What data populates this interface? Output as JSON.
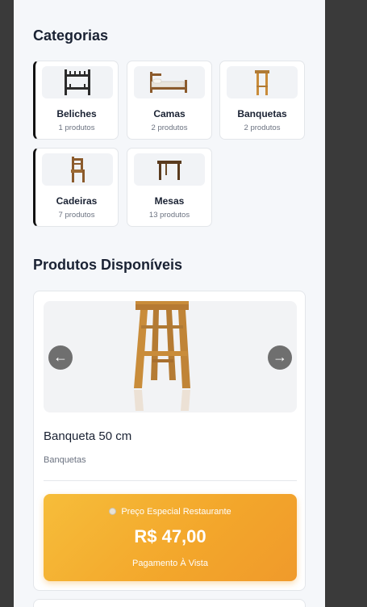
{
  "categories": {
    "title": "Categorias",
    "items": [
      {
        "name": "Beliches",
        "count": "1 produtos",
        "icon": "bunk-bed-icon"
      },
      {
        "name": "Camas",
        "count": "2 produtos",
        "icon": "bed-icon"
      },
      {
        "name": "Banquetas",
        "count": "2 produtos",
        "icon": "stool-icon"
      },
      {
        "name": "Cadeiras",
        "count": "7 produtos",
        "icon": "chair-icon"
      },
      {
        "name": "Mesas",
        "count": "13 produtos",
        "icon": "table-icon"
      }
    ]
  },
  "products": {
    "title": "Produtos Disponíveis",
    "current": {
      "name": "Banqueta 50 cm",
      "category": "Banquetas",
      "image": "wooden-stool-image",
      "prev_label": "←",
      "next_label": "→",
      "price": {
        "label": "Preço Especial Restaurante",
        "value": "R$ 47,00",
        "payment": "Pagamento À Vista"
      }
    }
  },
  "colors": {
    "background": "#3a3a3a",
    "page": "#f5f7fa",
    "price_gradient_start": "#f6bd3a",
    "price_gradient_end": "#f09a2b",
    "wood": "#c98c3a"
  }
}
